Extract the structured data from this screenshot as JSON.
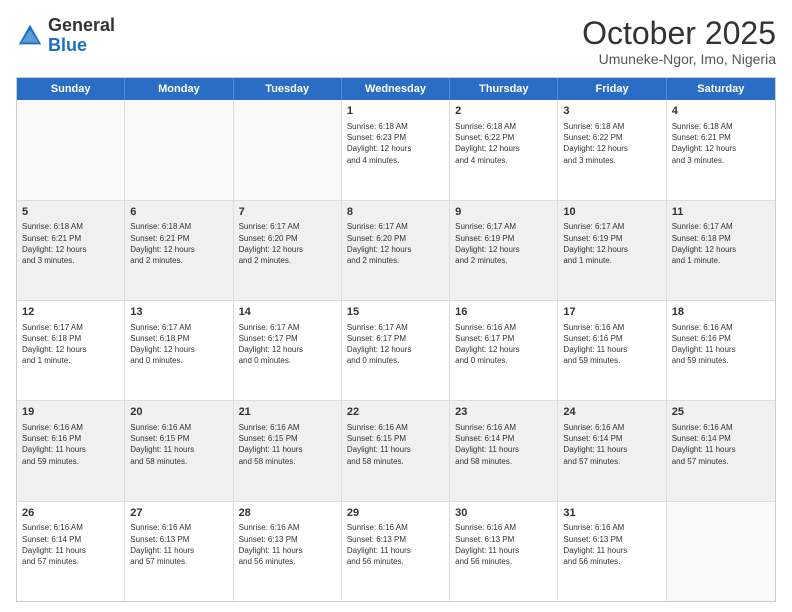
{
  "header": {
    "logo_general": "General",
    "logo_blue": "Blue",
    "title": "October 2025",
    "subtitle": "Umuneke-Ngor, Imo, Nigeria"
  },
  "weekdays": [
    "Sunday",
    "Monday",
    "Tuesday",
    "Wednesday",
    "Thursday",
    "Friday",
    "Saturday"
  ],
  "weeks": [
    [
      {
        "day": "",
        "text": "",
        "empty": true
      },
      {
        "day": "",
        "text": "",
        "empty": true
      },
      {
        "day": "",
        "text": "",
        "empty": true
      },
      {
        "day": "1",
        "text": "Sunrise: 6:18 AM\nSunset: 6:23 PM\nDaylight: 12 hours\nand 4 minutes.",
        "empty": false
      },
      {
        "day": "2",
        "text": "Sunrise: 6:18 AM\nSunset: 6:22 PM\nDaylight: 12 hours\nand 4 minutes.",
        "empty": false
      },
      {
        "day": "3",
        "text": "Sunrise: 6:18 AM\nSunset: 6:22 PM\nDaylight: 12 hours\nand 3 minutes.",
        "empty": false
      },
      {
        "day": "4",
        "text": "Sunrise: 6:18 AM\nSunset: 6:21 PM\nDaylight: 12 hours\nand 3 minutes.",
        "empty": false
      }
    ],
    [
      {
        "day": "5",
        "text": "Sunrise: 6:18 AM\nSunset: 6:21 PM\nDaylight: 12 hours\nand 3 minutes.",
        "empty": false
      },
      {
        "day": "6",
        "text": "Sunrise: 6:18 AM\nSunset: 6:21 PM\nDaylight: 12 hours\nand 2 minutes.",
        "empty": false
      },
      {
        "day": "7",
        "text": "Sunrise: 6:17 AM\nSunset: 6:20 PM\nDaylight: 12 hours\nand 2 minutes.",
        "empty": false
      },
      {
        "day": "8",
        "text": "Sunrise: 6:17 AM\nSunset: 6:20 PM\nDaylight: 12 hours\nand 2 minutes.",
        "empty": false
      },
      {
        "day": "9",
        "text": "Sunrise: 6:17 AM\nSunset: 6:19 PM\nDaylight: 12 hours\nand 2 minutes.",
        "empty": false
      },
      {
        "day": "10",
        "text": "Sunrise: 6:17 AM\nSunset: 6:19 PM\nDaylight: 12 hours\nand 1 minute.",
        "empty": false
      },
      {
        "day": "11",
        "text": "Sunrise: 6:17 AM\nSunset: 6:18 PM\nDaylight: 12 hours\nand 1 minute.",
        "empty": false
      }
    ],
    [
      {
        "day": "12",
        "text": "Sunrise: 6:17 AM\nSunset: 6:18 PM\nDaylight: 12 hours\nand 1 minute.",
        "empty": false
      },
      {
        "day": "13",
        "text": "Sunrise: 6:17 AM\nSunset: 6:18 PM\nDaylight: 12 hours\nand 0 minutes.",
        "empty": false
      },
      {
        "day": "14",
        "text": "Sunrise: 6:17 AM\nSunset: 6:17 PM\nDaylight: 12 hours\nand 0 minutes.",
        "empty": false
      },
      {
        "day": "15",
        "text": "Sunrise: 6:17 AM\nSunset: 6:17 PM\nDaylight: 12 hours\nand 0 minutes.",
        "empty": false
      },
      {
        "day": "16",
        "text": "Sunrise: 6:16 AM\nSunset: 6:17 PM\nDaylight: 12 hours\nand 0 minutes.",
        "empty": false
      },
      {
        "day": "17",
        "text": "Sunrise: 6:16 AM\nSunset: 6:16 PM\nDaylight: 11 hours\nand 59 minutes.",
        "empty": false
      },
      {
        "day": "18",
        "text": "Sunrise: 6:16 AM\nSunset: 6:16 PM\nDaylight: 11 hours\nand 59 minutes.",
        "empty": false
      }
    ],
    [
      {
        "day": "19",
        "text": "Sunrise: 6:16 AM\nSunset: 6:16 PM\nDaylight: 11 hours\nand 59 minutes.",
        "empty": false
      },
      {
        "day": "20",
        "text": "Sunrise: 6:16 AM\nSunset: 6:15 PM\nDaylight: 11 hours\nand 58 minutes.",
        "empty": false
      },
      {
        "day": "21",
        "text": "Sunrise: 6:16 AM\nSunset: 6:15 PM\nDaylight: 11 hours\nand 58 minutes.",
        "empty": false
      },
      {
        "day": "22",
        "text": "Sunrise: 6:16 AM\nSunset: 6:15 PM\nDaylight: 11 hours\nand 58 minutes.",
        "empty": false
      },
      {
        "day": "23",
        "text": "Sunrise: 6:16 AM\nSunset: 6:14 PM\nDaylight: 11 hours\nand 58 minutes.",
        "empty": false
      },
      {
        "day": "24",
        "text": "Sunrise: 6:16 AM\nSunset: 6:14 PM\nDaylight: 11 hours\nand 57 minutes.",
        "empty": false
      },
      {
        "day": "25",
        "text": "Sunrise: 6:16 AM\nSunset: 6:14 PM\nDaylight: 11 hours\nand 57 minutes.",
        "empty": false
      }
    ],
    [
      {
        "day": "26",
        "text": "Sunrise: 6:16 AM\nSunset: 6:14 PM\nDaylight: 11 hours\nand 57 minutes.",
        "empty": false
      },
      {
        "day": "27",
        "text": "Sunrise: 6:16 AM\nSunset: 6:13 PM\nDaylight: 11 hours\nand 57 minutes.",
        "empty": false
      },
      {
        "day": "28",
        "text": "Sunrise: 6:16 AM\nSunset: 6:13 PM\nDaylight: 11 hours\nand 56 minutes.",
        "empty": false
      },
      {
        "day": "29",
        "text": "Sunrise: 6:16 AM\nSunset: 6:13 PM\nDaylight: 11 hours\nand 56 minutes.",
        "empty": false
      },
      {
        "day": "30",
        "text": "Sunrise: 6:16 AM\nSunset: 6:13 PM\nDaylight: 11 hours\nand 56 minutes.",
        "empty": false
      },
      {
        "day": "31",
        "text": "Sunrise: 6:16 AM\nSunset: 6:13 PM\nDaylight: 11 hours\nand 56 minutes.",
        "empty": false
      },
      {
        "day": "",
        "text": "",
        "empty": true
      }
    ]
  ]
}
